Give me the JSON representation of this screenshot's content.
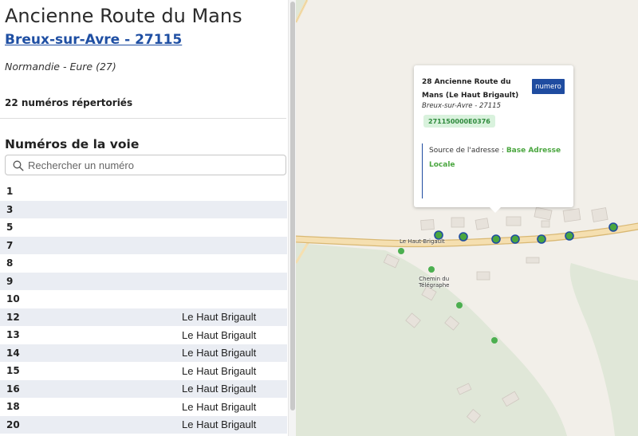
{
  "panel": {
    "street_title": "Ancienne Route du Mans",
    "commune_link": "Breux-sur-Avre - 27115",
    "region": "Normandie - Eure (27)",
    "count_text": "22 numéros répertoriés",
    "numbers_title": "Numéros de la voie",
    "search_placeholder": "Rechercher un numéro",
    "numbers": [
      {
        "num": "1",
        "locality": ""
      },
      {
        "num": "3",
        "locality": ""
      },
      {
        "num": "5",
        "locality": ""
      },
      {
        "num": "7",
        "locality": ""
      },
      {
        "num": "8",
        "locality": ""
      },
      {
        "num": "9",
        "locality": ""
      },
      {
        "num": "10",
        "locality": ""
      },
      {
        "num": "12",
        "locality": "Le Haut Brigault"
      },
      {
        "num": "13",
        "locality": "Le Haut Brigault"
      },
      {
        "num": "14",
        "locality": "Le Haut Brigault"
      },
      {
        "num": "15",
        "locality": "Le Haut Brigault"
      },
      {
        "num": "16",
        "locality": "Le Haut Brigault"
      },
      {
        "num": "18",
        "locality": "Le Haut Brigault"
      },
      {
        "num": "20",
        "locality": "Le Haut Brigault"
      }
    ]
  },
  "map": {
    "labels": {
      "road": "Le Haut-Brigault",
      "chemin_line1": "Chemin du",
      "chemin_line2": "Télégraphe"
    },
    "popup": {
      "title": "28 Ancienne Route du Mans (Le Haut Brigault)",
      "badge": "numero",
      "commune": "Breux-sur-Avre - 27115",
      "code": "271150000E0376",
      "source_label": "Source de l'adresse :",
      "source_value": "Base Adresse Locale"
    },
    "colors": {
      "land": "#f2efe9",
      "field": "#e0e7d8",
      "road_fill": "#f5dfb0",
      "road_edge": "#d9b873",
      "marker_blue_fill": "#4aa63f",
      "marker_blue_stroke": "#1f4ca0",
      "marker_green": "#4caf50",
      "accent": "#1f4ca0"
    }
  }
}
